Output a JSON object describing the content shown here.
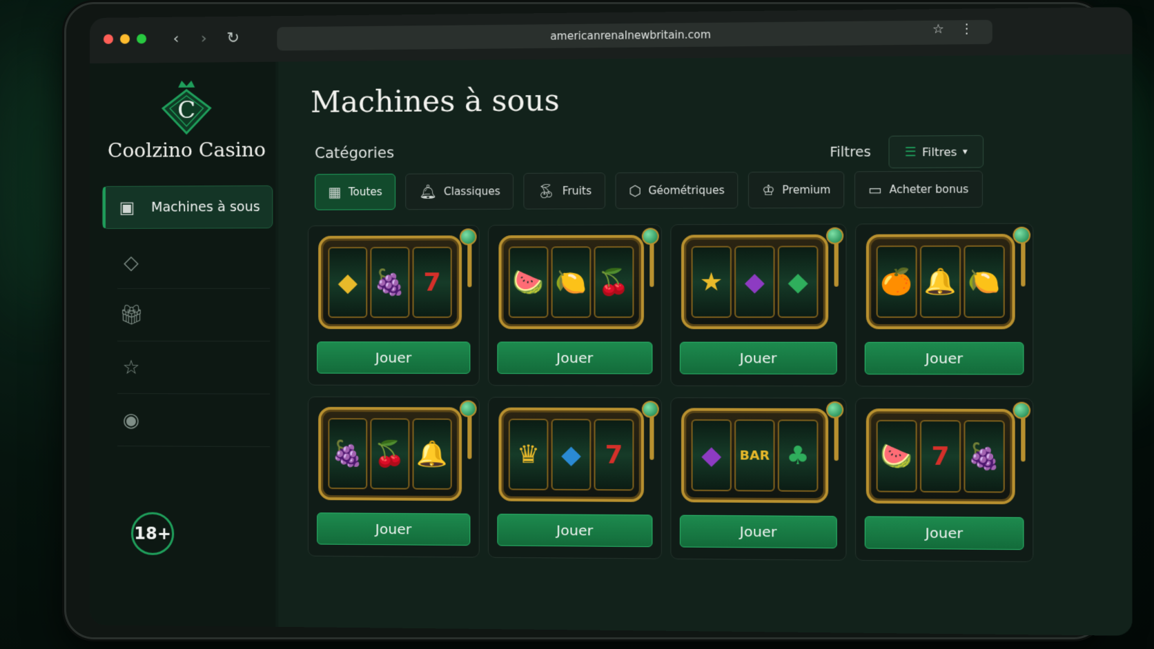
{
  "browser": {
    "url": "americanrenalnewbritain.com",
    "back_icon": "back-arrow-icon",
    "forward_icon": "forward-arrow-icon",
    "reload_icon": "reload-icon",
    "bookmark_icon": "star-icon",
    "menu_icon": "kebab-menu-icon",
    "dot_colors": [
      "#ff5f57",
      "#febc2e",
      "#28c840"
    ]
  },
  "sidebar": {
    "logo_text": "Coolzino Casino",
    "logo_letter": "C",
    "active_item": {
      "label": "Machines à sous",
      "icon": "slot-machine-icon"
    },
    "items": [
      {
        "icon": "diamond-icon"
      },
      {
        "icon": "gift-icon"
      },
      {
        "icon": "star-icon"
      },
      {
        "icon": "user-icon"
      }
    ],
    "age_badge": "18+"
  },
  "main": {
    "title": "Machines à sous",
    "categories_label": "Catégories",
    "filters_label": "Filtres",
    "filters_button": "Filtres",
    "chips": [
      {
        "label": "Toutes",
        "icon": "grid-icon",
        "active": true
      },
      {
        "label": "Classiques",
        "icon": "bell-icon",
        "active": false
      },
      {
        "label": "Fruits",
        "icon": "cherry-icon",
        "active": false
      },
      {
        "label": "Géométriques",
        "icon": "hexagon-icon",
        "active": false
      },
      {
        "label": "Premium",
        "icon": "crown-icon",
        "active": false
      },
      {
        "label": "Acheter bonus",
        "icon": "ticket-icon",
        "active": false
      }
    ],
    "play_label": "Jouer",
    "machines": [
      {
        "symbols": [
          "◆",
          "🍇",
          "7"
        ],
        "classes": [
          "sym-gold",
          "sym-purple",
          "sym-red"
        ]
      },
      {
        "symbols": [
          "🍉",
          "🍋",
          "🍒"
        ],
        "classes": [
          "sym-green",
          "sym-gold",
          "sym-red"
        ]
      },
      {
        "symbols": [
          "★",
          "◆",
          "◆"
        ],
        "classes": [
          "sym-gold",
          "sym-purple",
          "sym-green"
        ]
      },
      {
        "symbols": [
          "🍊",
          "🔔",
          "🍋"
        ],
        "classes": [
          "sym-orange",
          "sym-gold",
          "sym-gold"
        ]
      },
      {
        "symbols": [
          "🍇",
          "🍒",
          "🔔"
        ],
        "classes": [
          "sym-purple",
          "sym-red",
          "sym-gold"
        ]
      },
      {
        "symbols": [
          "♛",
          "◆",
          "7"
        ],
        "classes": [
          "sym-gold",
          "sym-blue",
          "sym-red"
        ]
      },
      {
        "symbols": [
          "◆",
          "BAR",
          "♣"
        ],
        "classes": [
          "sym-purple",
          "sym-gold",
          "sym-green"
        ]
      },
      {
        "symbols": [
          "🍉",
          "7",
          "🍇"
        ],
        "classes": [
          "sym-green",
          "sym-red",
          "sym-purple"
        ]
      }
    ]
  }
}
